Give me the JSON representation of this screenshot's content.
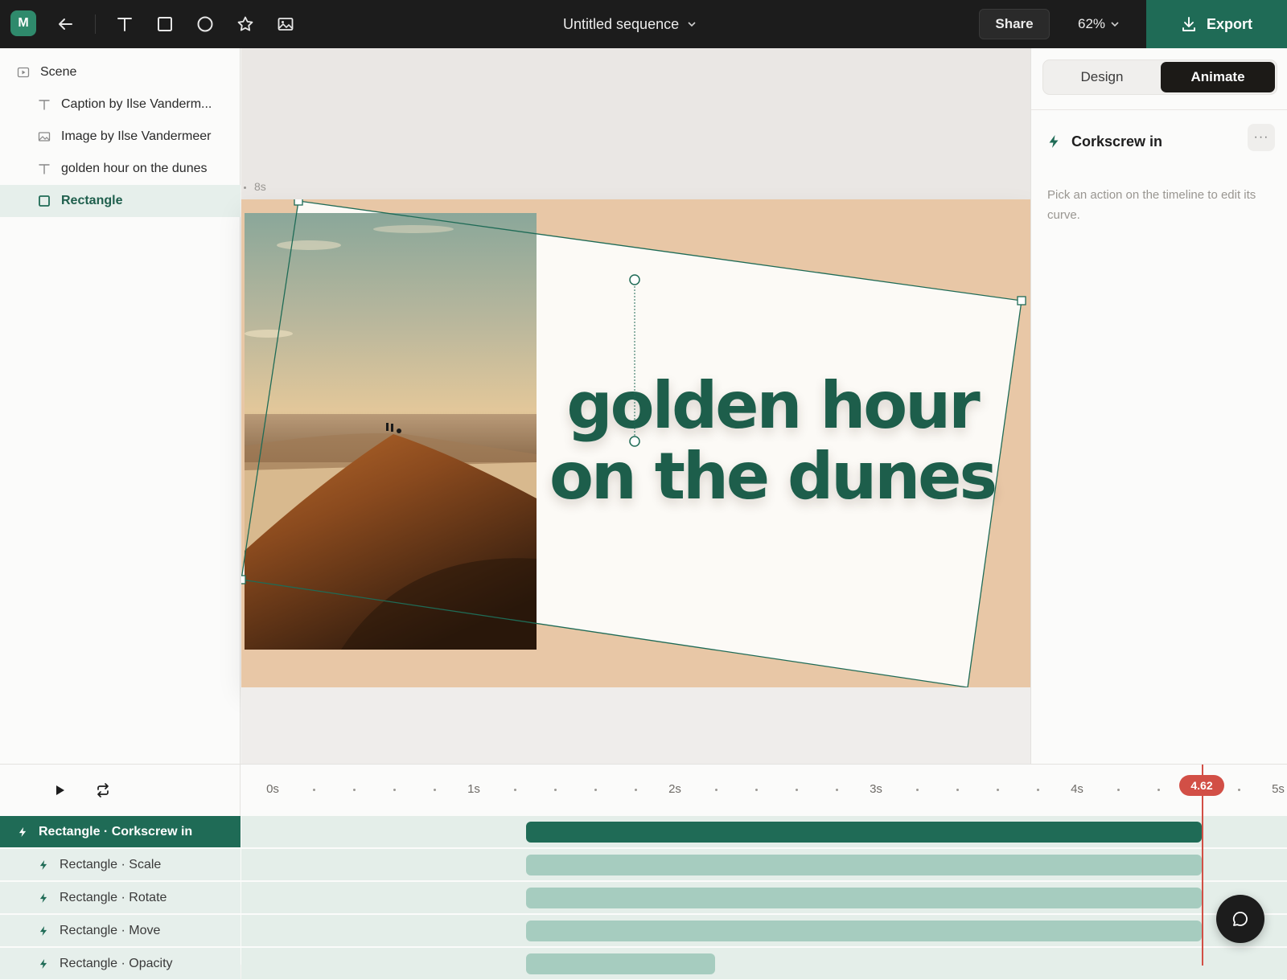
{
  "app": {
    "logo_letter": "M"
  },
  "toolbar": {
    "tools": [
      "back-arrow-icon",
      "text-tool-icon",
      "rectangle-tool-icon",
      "ellipse-tool-icon",
      "star-tool-icon",
      "image-tool-icon"
    ],
    "doc_title": "Untitled sequence",
    "share_label": "Share",
    "zoom": "62%",
    "export_label": "Export"
  },
  "layers": {
    "items": [
      {
        "label": "Scene",
        "icon": "scene-icon"
      },
      {
        "label": "Caption by Ilse Vanderm...",
        "icon": "text-icon"
      },
      {
        "label": "Image by Ilse Vandermeer",
        "icon": "image-icon"
      },
      {
        "label": "golden hour on the dunes",
        "icon": "text-icon"
      },
      {
        "label": "Rectangle",
        "icon": "rectangle-icon",
        "selected": true
      }
    ]
  },
  "canvas": {
    "time_label": "8s",
    "headline_line1": "golden hour",
    "headline_line2": "on the dunes",
    "colors": {
      "frame_bg": "#e8c7a6",
      "card_bg": "#fcfaf6",
      "headline": "#1d5e4b",
      "selection": "#1f6b56"
    }
  },
  "inspector": {
    "tabs": [
      "Design",
      "Animate"
    ],
    "active_tab": "Animate",
    "action_title": "Corkscrew in",
    "more_label": "···",
    "hint": "Pick an action on the timeline to edit its curve."
  },
  "timeline": {
    "ruler_labels": [
      "0s",
      "1s",
      "2s",
      "3s",
      "4s",
      "5s"
    ],
    "playhead": "4.62",
    "tracks": [
      {
        "label": "Rectangle · Corkscrew in",
        "active": true,
        "start": 1.26,
        "end": 4.62
      },
      {
        "label": "Rectangle · Scale",
        "active": false,
        "start": 1.26,
        "end": 4.62
      },
      {
        "label": "Rectangle · Rotate",
        "active": false,
        "start": 1.26,
        "end": 4.62
      },
      {
        "label": "Rectangle · Move",
        "active": false,
        "start": 1.26,
        "end": 4.62
      },
      {
        "label": "Rectangle · Opacity",
        "active": false,
        "start": 1.26,
        "end": 2.2
      }
    ],
    "colors": {
      "active_bar": "#1f6b56",
      "bar": "#a6ccbf",
      "playhead": "#d24f46"
    }
  }
}
